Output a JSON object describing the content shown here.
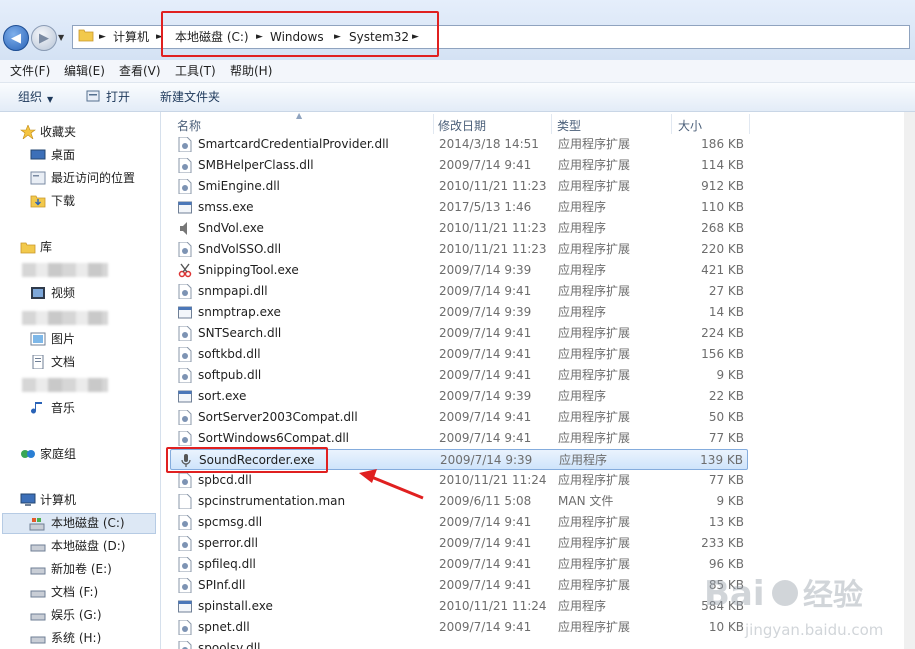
{
  "address": {
    "crumbs": [
      "计算机",
      "本地磁盘 (C:)",
      "Windows",
      "System32"
    ]
  },
  "menu": [
    "文件(F)",
    "编辑(E)",
    "查看(V)",
    "工具(T)",
    "帮助(H)"
  ],
  "toolbar": {
    "organize": "组织",
    "open": "打开",
    "new_folder": "新建文件夹"
  },
  "nav": {
    "favorites": {
      "label": "收藏夹",
      "items": [
        "桌面",
        "最近访问的位置",
        "下载"
      ]
    },
    "libraries": {
      "label": "库",
      "items": [
        "视频",
        "图片",
        "文档",
        "音乐"
      ]
    },
    "homegroup": "家庭组",
    "computer": {
      "label": "计算机",
      "drives": [
        "本地磁盘 (C:)",
        "本地磁盘 (D:)",
        "新加卷 (E:)",
        "文档 (F:)",
        "娱乐 (G:)",
        "系统 (H:)"
      ]
    }
  },
  "columns": {
    "name": "名称",
    "date": "修改日期",
    "type": "类型",
    "size": "大小"
  },
  "files": [
    {
      "name": "SmartcardCredentialProvider.dll",
      "date": "2014/3/18 14:51",
      "type": "应用程序扩展",
      "size": "186 KB",
      "icon": "dll-icon"
    },
    {
      "name": "SMBHelperClass.dll",
      "date": "2009/7/14 9:41",
      "type": "应用程序扩展",
      "size": "114 KB",
      "icon": "dll-icon"
    },
    {
      "name": "SmiEngine.dll",
      "date": "2010/11/21 11:23",
      "type": "应用程序扩展",
      "size": "912 KB",
      "icon": "dll-icon"
    },
    {
      "name": "smss.exe",
      "date": "2017/5/13 1:46",
      "type": "应用程序",
      "size": "110 KB",
      "icon": "exe-icon"
    },
    {
      "name": "SndVol.exe",
      "date": "2010/11/21 11:23",
      "type": "应用程序",
      "size": "268 KB",
      "icon": "speaker-icon"
    },
    {
      "name": "SndVolSSO.dll",
      "date": "2010/11/21 11:23",
      "type": "应用程序扩展",
      "size": "220 KB",
      "icon": "dll-icon"
    },
    {
      "name": "SnippingTool.exe",
      "date": "2009/7/14 9:39",
      "type": "应用程序",
      "size": "421 KB",
      "icon": "scissors-icon"
    },
    {
      "name": "snmpapi.dll",
      "date": "2009/7/14 9:41",
      "type": "应用程序扩展",
      "size": "27 KB",
      "icon": "dll-icon"
    },
    {
      "name": "snmptrap.exe",
      "date": "2009/7/14 9:39",
      "type": "应用程序",
      "size": "14 KB",
      "icon": "exe-icon"
    },
    {
      "name": "SNTSearch.dll",
      "date": "2009/7/14 9:41",
      "type": "应用程序扩展",
      "size": "224 KB",
      "icon": "dll-icon"
    },
    {
      "name": "softkbd.dll",
      "date": "2009/7/14 9:41",
      "type": "应用程序扩展",
      "size": "156 KB",
      "icon": "dll-icon"
    },
    {
      "name": "softpub.dll",
      "date": "2009/7/14 9:41",
      "type": "应用程序扩展",
      "size": "9 KB",
      "icon": "dll-icon"
    },
    {
      "name": "sort.exe",
      "date": "2009/7/14 9:39",
      "type": "应用程序",
      "size": "22 KB",
      "icon": "exe-icon"
    },
    {
      "name": "SortServer2003Compat.dll",
      "date": "2009/7/14 9:41",
      "type": "应用程序扩展",
      "size": "50 KB",
      "icon": "dll-icon"
    },
    {
      "name": "SortWindows6Compat.dll",
      "date": "2009/7/14 9:41",
      "type": "应用程序扩展",
      "size": "77 KB",
      "icon": "dll-icon"
    },
    {
      "name": "SoundRecorder.exe",
      "date": "2009/7/14 9:39",
      "type": "应用程序",
      "size": "139 KB",
      "icon": "microphone-icon",
      "selected": true
    },
    {
      "name": "spbcd.dll",
      "date": "2010/11/21 11:24",
      "type": "应用程序扩展",
      "size": "77 KB",
      "icon": "dll-icon"
    },
    {
      "name": "spcinstrumentation.man",
      "date": "2009/6/11 5:08",
      "type": "MAN 文件",
      "size": "9 KB",
      "icon": "file-icon"
    },
    {
      "name": "spcmsg.dll",
      "date": "2009/7/14 9:41",
      "type": "应用程序扩展",
      "size": "13 KB",
      "icon": "dll-icon"
    },
    {
      "name": "sperror.dll",
      "date": "2009/7/14 9:41",
      "type": "应用程序扩展",
      "size": "233 KB",
      "icon": "dll-icon"
    },
    {
      "name": "spfileq.dll",
      "date": "2009/7/14 9:41",
      "type": "应用程序扩展",
      "size": "96 KB",
      "icon": "dll-icon"
    },
    {
      "name": "SPInf.dll",
      "date": "2009/7/14 9:41",
      "type": "应用程序扩展",
      "size": "85 KB",
      "icon": "dll-icon"
    },
    {
      "name": "spinstall.exe",
      "date": "2010/11/21 11:24",
      "type": "应用程序",
      "size": "584 KB",
      "icon": "exe-icon"
    },
    {
      "name": "spnet.dll",
      "date": "2009/7/14 9:41",
      "type": "应用程序扩展",
      "size": "10 KB",
      "icon": "dll-icon"
    },
    {
      "name": "spoolsv.dll",
      "date": "",
      "type": "",
      "size": "",
      "icon": "dll-icon"
    }
  ],
  "colors": {
    "highlight": "#e02020",
    "selection": "#cfe4fb",
    "accent": "#2a63b7"
  }
}
